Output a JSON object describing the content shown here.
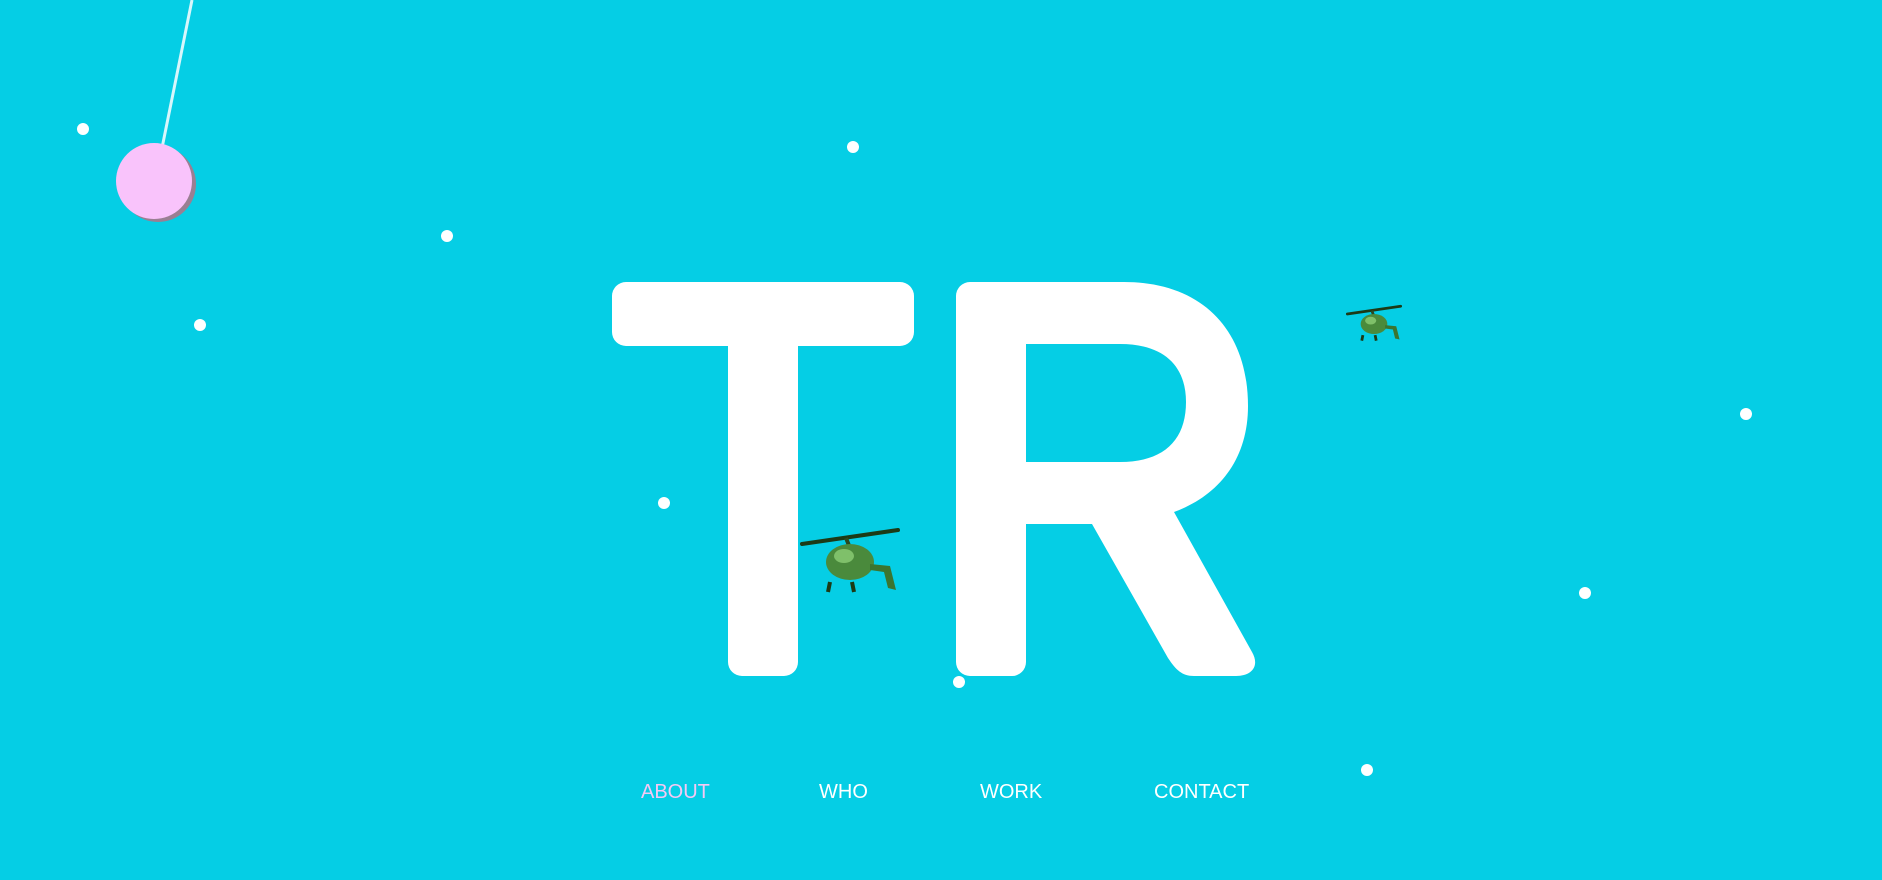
{
  "colors": {
    "background": "#05cee5",
    "logo": "#ffffff",
    "dots": "#ffffff",
    "pendulum_ball": "#f9c3fb",
    "pendulum_shadow": "#9a7f93",
    "pendulum_string": "#d8f6fb",
    "nav_text": "#ffffff",
    "nav_active": "#f6c8f4",
    "helicopter_body": "#4a8a3c"
  },
  "logo": {
    "letters": "TR"
  },
  "nav": {
    "items": [
      {
        "label": "ABOUT",
        "active": true
      },
      {
        "label": "WHO",
        "active": false
      },
      {
        "label": "WORK",
        "active": false
      },
      {
        "label": "CONTACT",
        "active": false
      }
    ]
  },
  "decorations": {
    "icons": [
      "pendulum-ball-icon",
      "helicopter-icon",
      "snow-dot-icon"
    ]
  }
}
